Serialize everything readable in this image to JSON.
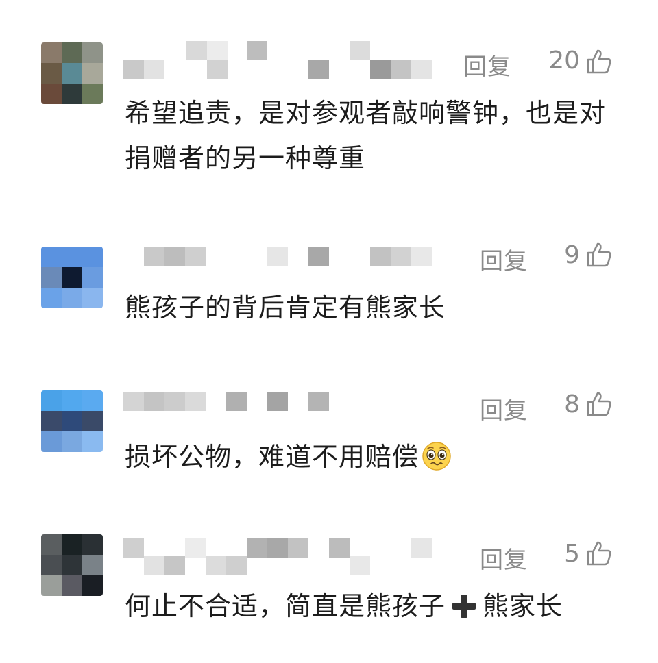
{
  "comments": [
    {
      "reply_label": "回复",
      "likes": "20",
      "text": "希望追责，是对参观者敲响警钟，也是对捐赠者的另一种尊重",
      "avatar_colors": [
        "#8a7a6a",
        "#5e6a55",
        "#8f9389",
        "#6a5a45",
        "#5a8a95",
        "#a8a89a",
        "#6a4a3a",
        "#2e3a3a",
        "#6b7a5a"
      ]
    },
    {
      "reply_label": "回复",
      "likes": "9",
      "text": "熊孩子的背后肯定有熊家长",
      "avatar_colors": [
        "#5a92e0",
        "#5a92e0",
        "#5a92e0",
        "#6a8ab8",
        "#0e1a30",
        "#6a9ce0",
        "#6aa2e8",
        "#7aaae8",
        "#8ab6ee"
      ]
    },
    {
      "reply_label": "回复",
      "likes": "8",
      "text": "损坏公物，难道不用赔偿",
      "emoji": "pleading-face-icon",
      "avatar_colors": [
        "#4aa2e8",
        "#52a8ee",
        "#5aaaf0",
        "#3a4a6a",
        "#2e4a7a",
        "#3a4a68",
        "#6a9ad8",
        "#7aa8e0",
        "#8abaf0"
      ]
    },
    {
      "reply_label": "回复",
      "likes": "5",
      "text_before": "何止不合适，简直是熊孩子",
      "text_after": "熊家长",
      "plus_icon": "heavy-plus-icon",
      "avatar_colors": [
        "#5a5e60",
        "#1a2224",
        "#2a3034",
        "#4a4e52",
        "#2e3438",
        "#7a8288",
        "#9a9e9a",
        "#5a5a62",
        "#1a1e24"
      ]
    }
  ],
  "colors": {
    "meta_gray": "#8a8a8a",
    "text": "#1c1c1c"
  }
}
